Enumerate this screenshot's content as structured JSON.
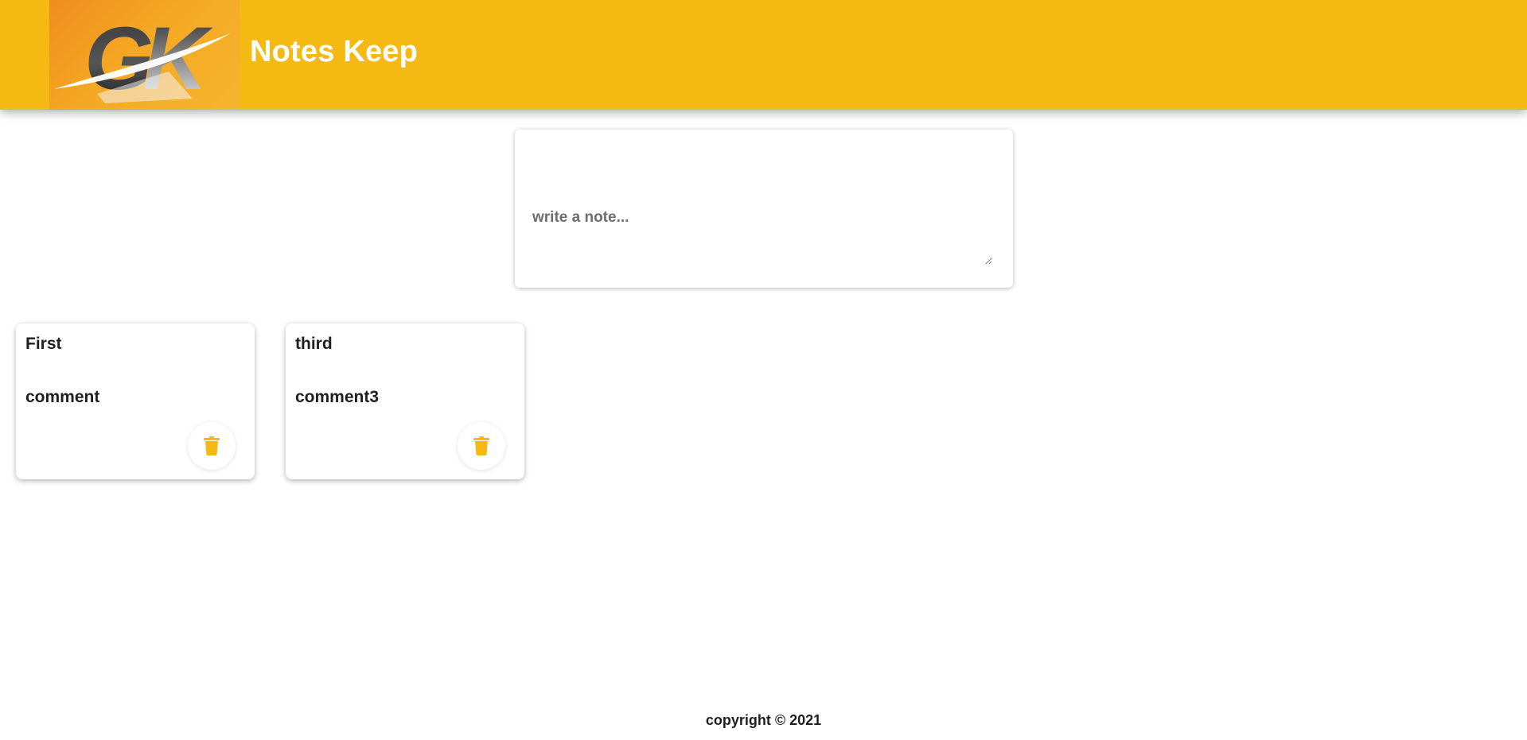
{
  "header": {
    "title": "Notes Keep",
    "logo_text": "GK",
    "background_color": "#f5b914"
  },
  "composer": {
    "placeholder": "write a note..."
  },
  "notes": [
    {
      "title": "First",
      "content": "comment",
      "delete_icon": "trash-icon"
    },
    {
      "title": "third",
      "content": "comment3",
      "delete_icon": "trash-icon"
    }
  ],
  "footer": {
    "text": "copyright © 2021"
  },
  "colors": {
    "accent": "#f5b914",
    "text": "#1f1f1f"
  }
}
